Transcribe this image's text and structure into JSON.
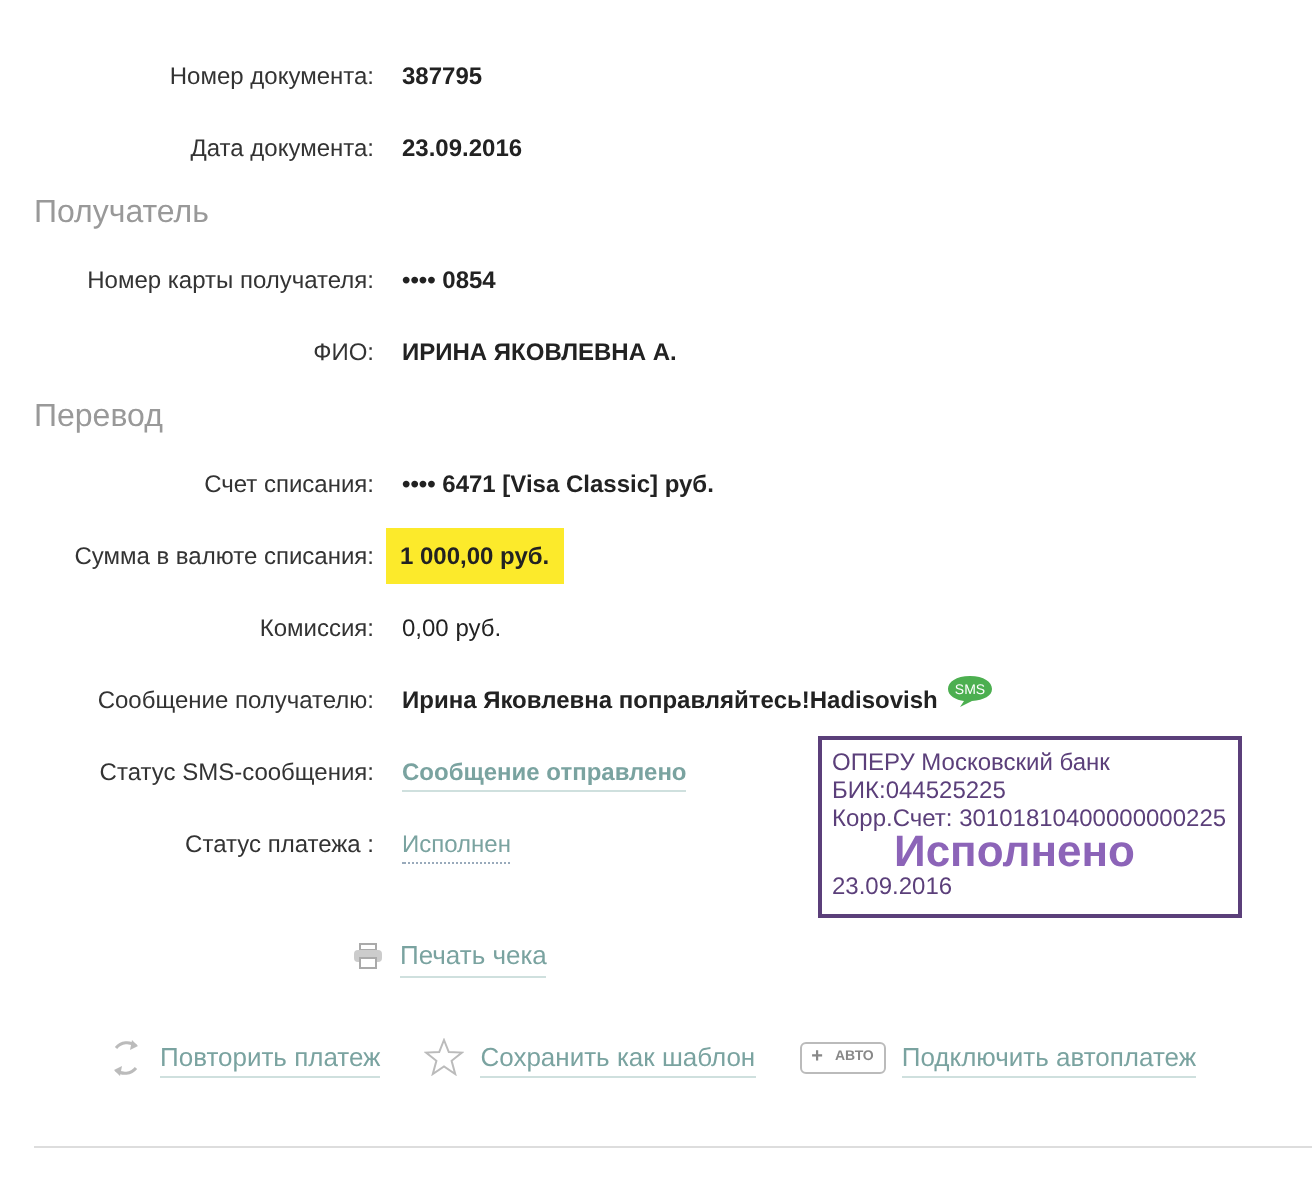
{
  "sections": [
    {
      "rows": [
        {
          "label": "Номер документа:",
          "value": "387795",
          "kind": "bold"
        },
        {
          "label": "Дата документа:",
          "value": "23.09.2016",
          "kind": "bold"
        }
      ]
    },
    {
      "title": "Получатель",
      "rows": [
        {
          "label": "Номер карты получателя:",
          "value": "•••• 0854",
          "kind": "bold"
        },
        {
          "label": "ФИО:",
          "value": "ИРИНА ЯКОВЛЕВНА А.",
          "kind": "bold"
        }
      ]
    },
    {
      "title": "Перевод",
      "rows": [
        {
          "label": "Счет списания:",
          "value": "•••• 6471  [Visa Classic]  руб.",
          "kind": "bold"
        },
        {
          "label": "Сумма в валюте списания:",
          "value": "1 000,00  руб.",
          "kind": "highlight"
        },
        {
          "label": "Комиссия:",
          "value": "0,00 руб.",
          "kind": "plain"
        },
        {
          "label": "Сообщение получателю:",
          "value": "Ирина Яковлевна поправляйтесь!Hadisovish",
          "kind": "message",
          "badge": "SMS"
        },
        {
          "label": "Статус SMS-сообщения:",
          "value": "Сообщение отправлено",
          "kind": "link"
        },
        {
          "label": "Статус платежа :",
          "value": "Исполнен",
          "kind": "dotted"
        }
      ]
    }
  ],
  "stamp": {
    "lines": [
      "ОПЕРУ Московский банк",
      "БИК:044525225",
      "Корр.Счет: 30101810400000000225"
    ],
    "status": "Исполнено",
    "date": "23.09.2016"
  },
  "print": {
    "label": "Печать чека"
  },
  "actions": [
    {
      "kind": "repeat",
      "label": "Повторить платеж"
    },
    {
      "kind": "star",
      "label": "Сохранить как шаблон"
    },
    {
      "kind": "auto",
      "badge_plus": "+",
      "badge_text": "АВТО",
      "label": "Подключить автоплатеж"
    }
  ]
}
